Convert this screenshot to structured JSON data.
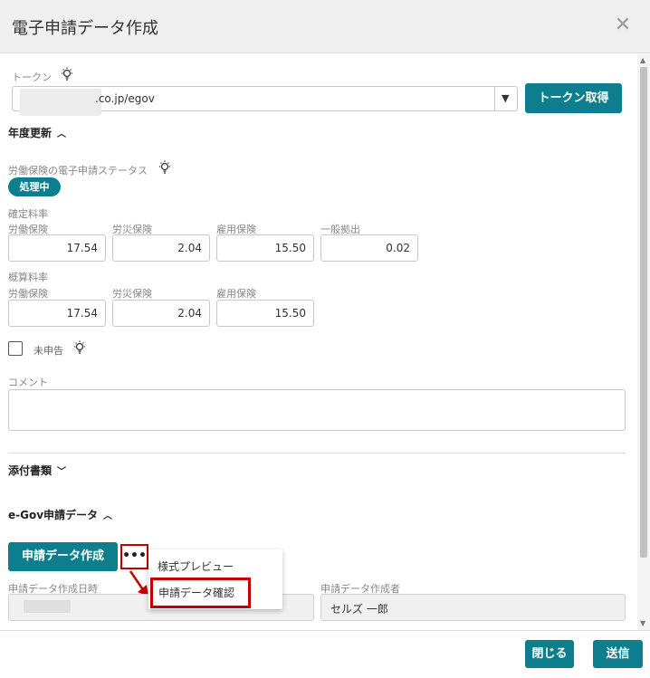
{
  "dialog": {
    "title": "電子申請データ作成"
  },
  "token": {
    "label": "トークン",
    "value": ".co.jp/egov",
    "button": "トークン取得"
  },
  "annual": {
    "section_title": "年度更新",
    "status_label": "労働保険の電子申請ステータス",
    "status_badge": "処理中",
    "confirmed": {
      "label": "確定料率",
      "fields": [
        {
          "label": "労働保険",
          "value": "17.54"
        },
        {
          "label": "労災保険",
          "value": "2.04"
        },
        {
          "label": "雇用保険",
          "value": "15.50"
        },
        {
          "label": "一般拠出",
          "value": "0.02"
        }
      ]
    },
    "estimated": {
      "label": "概算料率",
      "fields": [
        {
          "label": "労働保険",
          "value": "17.54"
        },
        {
          "label": "労災保険",
          "value": "2.04"
        },
        {
          "label": "雇用保険",
          "value": "15.50"
        }
      ]
    },
    "unreported_label": "未申告",
    "comment_label": "コメント"
  },
  "attachments": {
    "section_title": "添付書類"
  },
  "egov": {
    "section_title": "e-Gov申請データ",
    "create_button": "申請データ作成",
    "more_button": "•••",
    "menu": {
      "item1": "様式プレビュー",
      "item2": "申請データ確認"
    },
    "created_at_label": "申請データ作成日時",
    "created_by_label": "申請データ作成者",
    "created_by_value": "セルズ 一郎"
  },
  "footer": {
    "close_button": "閉じる",
    "send_button": "送信"
  },
  "colors": {
    "accent": "#0c7e8e",
    "highlight": "#c00000"
  },
  "icons": {
    "hint": "lightbulb-icon",
    "close": "close-icon",
    "collapse": "chevron-up-icon",
    "expand": "chevron-down-icon"
  }
}
